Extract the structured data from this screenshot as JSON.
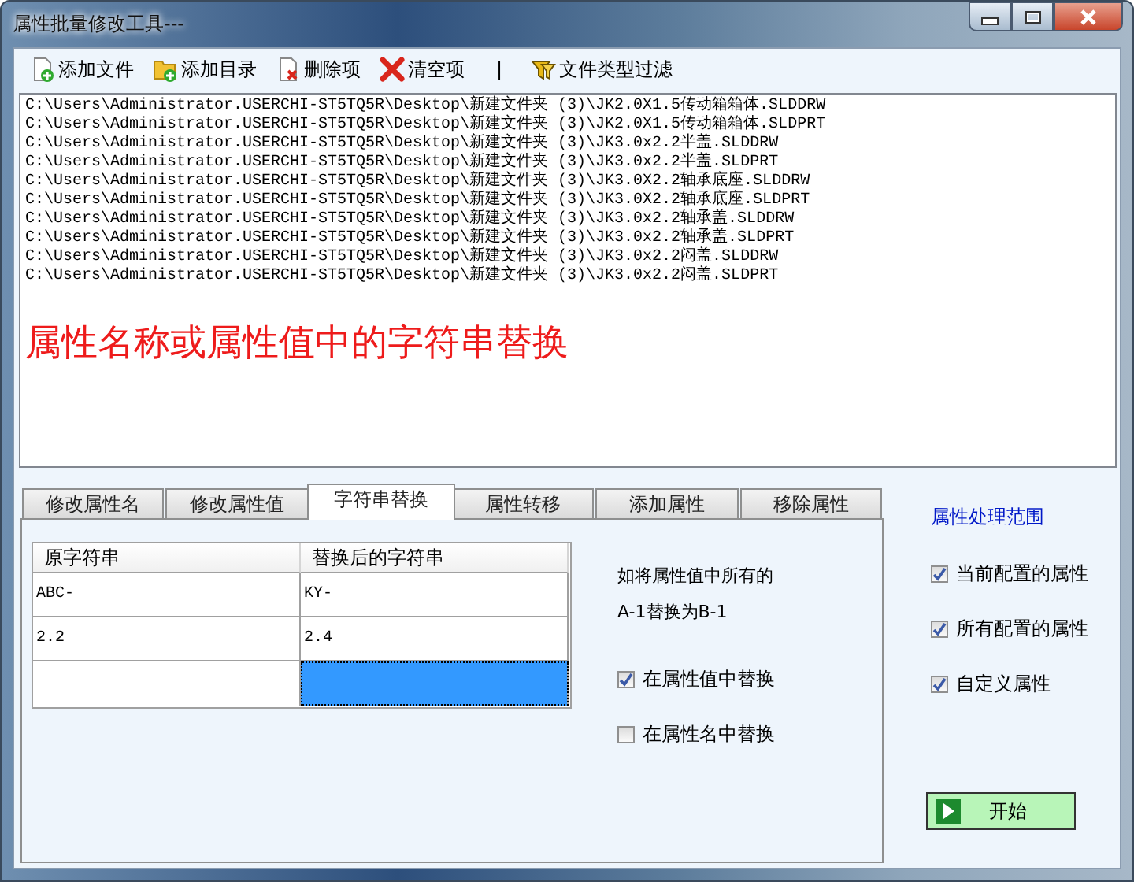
{
  "window": {
    "title": "属性批量修改工具---"
  },
  "toolbar": {
    "buttons": [
      {
        "label": "添加文件",
        "kind": "add-file"
      },
      {
        "label": "添加目录",
        "kind": "add-folder"
      },
      {
        "label": "删除项",
        "kind": "delete"
      },
      {
        "label": "清空项",
        "kind": "clear"
      },
      {
        "label": "|",
        "kind": "separator"
      },
      {
        "label": "文件类型过滤",
        "kind": "filter"
      }
    ]
  },
  "file_list": {
    "lines": [
      "C:\\Users\\Administrator.USERCHI-ST5TQ5R\\Desktop\\新建文件夹 (3)\\JK2.0X1.5传动箱箱体.SLDDRW",
      "C:\\Users\\Administrator.USERCHI-ST5TQ5R\\Desktop\\新建文件夹 (3)\\JK2.0X1.5传动箱箱体.SLDPRT",
      "C:\\Users\\Administrator.USERCHI-ST5TQ5R\\Desktop\\新建文件夹 (3)\\JK3.0x2.2半盖.SLDDRW",
      "C:\\Users\\Administrator.USERCHI-ST5TQ5R\\Desktop\\新建文件夹 (3)\\JK3.0x2.2半盖.SLDPRT",
      "C:\\Users\\Administrator.USERCHI-ST5TQ5R\\Desktop\\新建文件夹 (3)\\JK3.0X2.2轴承底座.SLDDRW",
      "C:\\Users\\Administrator.USERCHI-ST5TQ5R\\Desktop\\新建文件夹 (3)\\JK3.0X2.2轴承底座.SLDPRT",
      "C:\\Users\\Administrator.USERCHI-ST5TQ5R\\Desktop\\新建文件夹 (3)\\JK3.0x2.2轴承盖.SLDDRW",
      "C:\\Users\\Administrator.USERCHI-ST5TQ5R\\Desktop\\新建文件夹 (3)\\JK3.0x2.2轴承盖.SLDPRT",
      "C:\\Users\\Administrator.USERCHI-ST5TQ5R\\Desktop\\新建文件夹 (3)\\JK3.0x2.2闷盖.SLDDRW",
      "C:\\Users\\Administrator.USERCHI-ST5TQ5R\\Desktop\\新建文件夹 (3)\\JK3.0x2.2闷盖.SLDPRT"
    ],
    "banner": "属性名称或属性值中的字符串替换"
  },
  "tabs": [
    {
      "label": "修改属性名",
      "selected": false
    },
    {
      "label": "修改属性值",
      "selected": false
    },
    {
      "label": "字符串替换",
      "selected": true
    },
    {
      "label": "属性转移",
      "selected": false
    },
    {
      "label": "添加属性",
      "selected": false
    },
    {
      "label": "移除属性",
      "selected": false
    }
  ],
  "replace_table": {
    "columns": [
      "原字符串",
      "替换后的字符串"
    ],
    "rows": [
      {
        "cells": [
          {
            "text": "ABC-",
            "selected": false
          },
          {
            "text": "KY-",
            "selected": false
          }
        ]
      },
      {
        "cells": [
          {
            "text": "2.2",
            "selected": false
          },
          {
            "text": "2.4",
            "selected": false
          }
        ]
      },
      {
        "cells": [
          {
            "selected": false
          },
          {
            "selected": true
          }
        ]
      }
    ]
  },
  "hint": [
    "如将属性值中所有的",
    "A-1替换为B-1"
  ],
  "replace_options": [
    {
      "label": "在属性值中替换",
      "checked": true
    },
    {
      "label": "在属性名中替换",
      "checked": false
    }
  ],
  "scope": {
    "title": "属性处理范围",
    "options": [
      {
        "label": "当前配置的属性",
        "checked": true
      },
      {
        "label": "所有配置的属性",
        "checked": true
      },
      {
        "label": "自定义属性",
        "checked": true
      }
    ]
  },
  "start_button": {
    "label": "开始"
  }
}
